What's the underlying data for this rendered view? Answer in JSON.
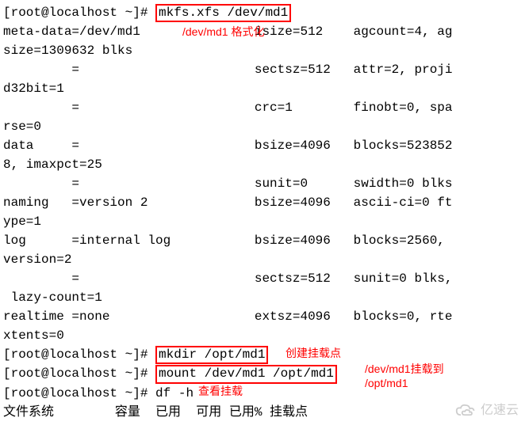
{
  "prompt1_a": "[root@localhost ~]# ",
  "cmd1": "mkfs.xfs /dev/md1",
  "anno1": "/dev/md1 格式化",
  "out": {
    "l1": "meta-data=/dev/md1               isize=512    agcount=4, ag",
    "l2": "size=1309632 blks",
    "l3": "         =                       sectsz=512   attr=2, proji",
    "l4": "d32bit=1",
    "l5": "         =                       crc=1        finobt=0, spa",
    "l6": "rse=0",
    "l7": "data     =                       bsize=4096   blocks=523852",
    "l8": "8, imaxpct=25",
    "l9": "         =                       sunit=0      swidth=0 blks",
    "l10": "naming   =version 2              bsize=4096   ascii-ci=0 ft",
    "l11": "ype=1",
    "l12": "log      =internal log           bsize=4096   blocks=2560, ",
    "l13": "version=2",
    "l14": "         =                       sectsz=512   sunit=0 blks,",
    "l15": " lazy-count=1",
    "l16": "realtime =none                   extsz=4096   blocks=0, rte",
    "l17": "xtents=0"
  },
  "prompt2_a": "[root@localhost ~]# ",
  "cmd2": "mkdir /opt/md1",
  "anno2": "创建挂载点",
  "prompt3_a": "[root@localhost ~]# ",
  "cmd3": "mount /dev/md1 /opt/md1",
  "anno3a": "/dev/md1挂载到",
  "anno3b": "/opt/md1",
  "prompt4": "[root@localhost ~]# df -h",
  "anno4": "查看挂载",
  "df_header": "文件系统        容量  已用  可用 已用% 挂载点",
  "watermark": "亿速云"
}
